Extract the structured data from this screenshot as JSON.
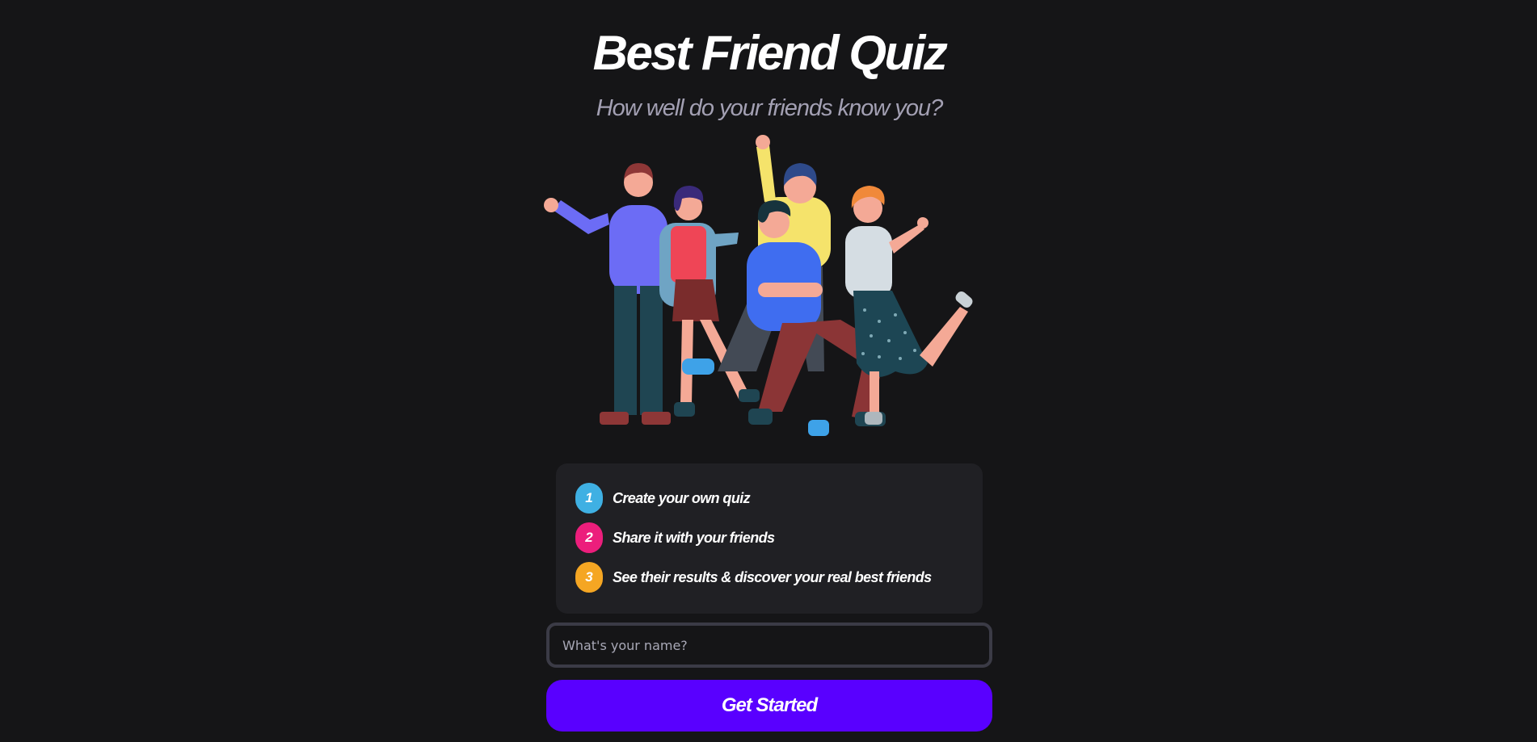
{
  "header": {
    "title": "Best Friend Quiz",
    "subtitle": "How well do your friends know you?"
  },
  "illustration": {
    "icon": "group-of-friends-illustration"
  },
  "steps": [
    {
      "number": "1",
      "text": "Create your own quiz",
      "color": "#3fb0e3"
    },
    {
      "number": "2",
      "text": "Share it with your friends",
      "color": "#ec1e7c"
    },
    {
      "number": "3",
      "text": "See their results & discover your real best friends",
      "color": "#f5a623"
    }
  ],
  "form": {
    "name_placeholder": "What's your name?",
    "name_value": "",
    "submit_label": "Get Started"
  },
  "colors": {
    "background": "#151517",
    "card": "#202024",
    "accent": "#5900ff",
    "subtitle": "#a3a0b3"
  }
}
